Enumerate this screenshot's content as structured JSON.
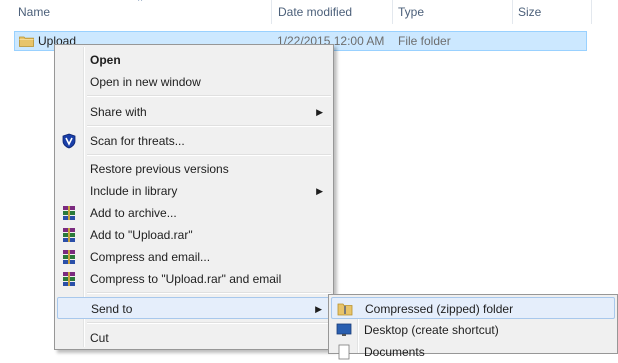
{
  "columns": {
    "name": "Name",
    "date_modified": "Date modified",
    "type": "Type",
    "size": "Size"
  },
  "file": {
    "name": "Upload",
    "date_modified": "1/22/2015 12:00 AM",
    "type": "File folder",
    "size": ""
  },
  "context_menu": {
    "open": "Open",
    "open_new_window": "Open in new window",
    "share_with": "Share with",
    "scan_threats": "Scan for threats...",
    "restore_versions": "Restore previous versions",
    "include_library": "Include in library",
    "add_archive": "Add to archive...",
    "add_upload_rar": "Add to \"Upload.rar\"",
    "compress_email": "Compress and email...",
    "compress_upload_email": "Compress to \"Upload.rar\" and email",
    "send_to": "Send to",
    "cut": "Cut"
  },
  "send_to_menu": {
    "compressed_folder": "Compressed (zipped) folder",
    "desktop_shortcut": "Desktop (create shortcut)",
    "documents": "Documents"
  },
  "colors": {
    "selection_bg": "#cce8ff",
    "selection_border": "#99d1ff",
    "menu_bg": "#f0f0f0",
    "menu_hover": "#e5eefb",
    "header_text": "#4c607a"
  }
}
